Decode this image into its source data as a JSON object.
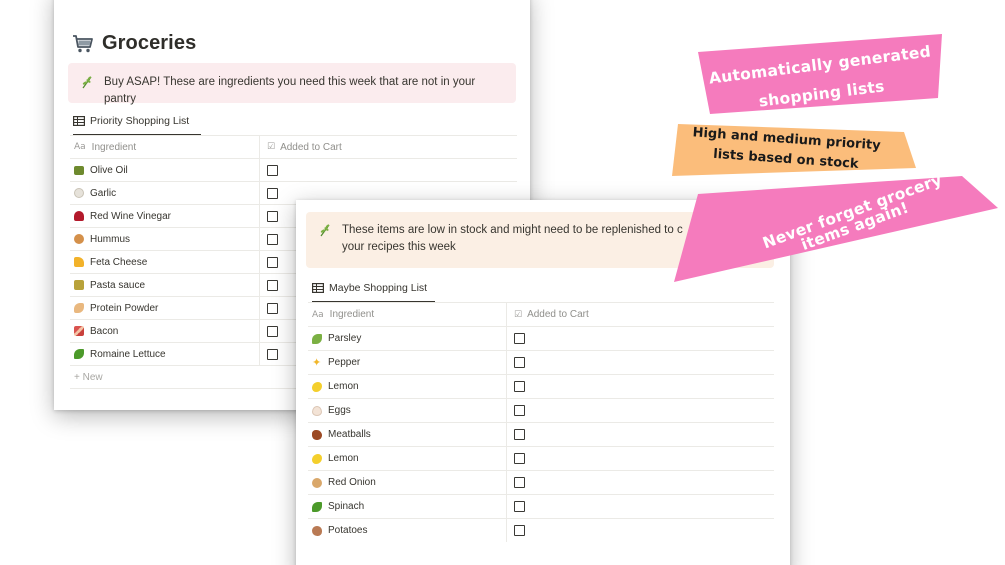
{
  "page": {
    "title": "Groceries",
    "icon": "shopping-cart-icon"
  },
  "priority_section": {
    "callout_icon": "herb-icon",
    "callout_text": "Buy ASAP! These are ingredients you need this week that are not in your pantry",
    "view_tab": "Priority Shopping List",
    "columns": {
      "name": "Ingredient",
      "name_icon": "Aa",
      "check": "Added to Cart"
    },
    "items": [
      {
        "label": "Olive Oil",
        "icon": "olive-icon"
      },
      {
        "label": "Garlic",
        "icon": "garlic-icon"
      },
      {
        "label": "Red Wine Vinegar",
        "icon": "wine-glass-icon"
      },
      {
        "label": "Hummus",
        "icon": "hummus-icon"
      },
      {
        "label": "Feta Cheese",
        "icon": "cheese-icon"
      },
      {
        "label": "Pasta sauce",
        "icon": "jar-icon"
      },
      {
        "label": "Protein Powder",
        "icon": "flexed-arm-icon"
      },
      {
        "label": "Bacon",
        "icon": "bacon-icon"
      },
      {
        "label": "Romaine Lettuce",
        "icon": "lettuce-icon"
      }
    ],
    "new_label": "+ New"
  },
  "maybe_section": {
    "callout_icon": "herb-icon",
    "callout_text": "These items are low in stock and might need to be replenished to c",
    "callout_text_line2": "your recipes this week",
    "view_tab": "Maybe Shopping List",
    "columns": {
      "name": "Ingredient",
      "name_icon": "Aa",
      "check": "Added to Cart"
    },
    "items": [
      {
        "label": "Parsley",
        "icon": "herb-icon"
      },
      {
        "label": "Pepper",
        "icon": "sparkles-icon"
      },
      {
        "label": "Lemon",
        "icon": "lemon-icon"
      },
      {
        "label": "Eggs",
        "icon": "egg-icon"
      },
      {
        "label": "Meatballs",
        "icon": "meat-icon"
      },
      {
        "label": "Lemon",
        "icon": "lemon-icon"
      },
      {
        "label": "Red Onion",
        "icon": "onion-icon"
      },
      {
        "label": "Spinach",
        "icon": "leafy-green-icon"
      },
      {
        "label": "Potatoes",
        "icon": "potato-icon"
      }
    ]
  },
  "banners": {
    "automatic": {
      "line1": "Automatically generated",
      "line2": "shopping lists",
      "color": "#f57bbd"
    },
    "priority": {
      "line1": "High and medium priority",
      "line2": "lists based on stock",
      "color": "#fbbd7b"
    },
    "never": {
      "line1": "Never forget grocery",
      "line2": "items  again!",
      "color": "#f57bbd"
    }
  },
  "colors": {
    "callout_pink": "#fbecee",
    "callout_peach": "#fbefe4",
    "text": "#37352f",
    "muted": "#908f8b"
  }
}
